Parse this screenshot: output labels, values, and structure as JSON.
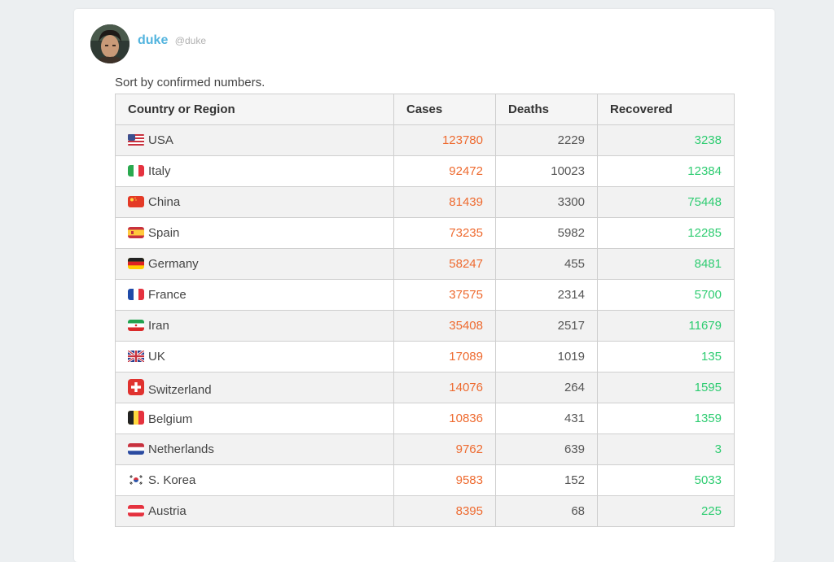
{
  "author": {
    "name": "duke",
    "handle": "@duke"
  },
  "intro": "Sort by confirmed numbers.",
  "colors": {
    "cases": "#ee6a2f",
    "recovered": "#2ecc71",
    "author": "#53b4de"
  },
  "table": {
    "headers": [
      "Country or Region",
      "Cases",
      "Deaths",
      "Recovered"
    ],
    "rows": [
      {
        "flag": "flag-usa-icon",
        "country": "USA",
        "cases": "123780",
        "deaths": "2229",
        "recovered": "3238"
      },
      {
        "flag": "flag-italy-icon",
        "country": "Italy",
        "cases": "92472",
        "deaths": "10023",
        "recovered": "12384"
      },
      {
        "flag": "flag-china-icon",
        "country": "China",
        "cases": "81439",
        "deaths": "3300",
        "recovered": "75448"
      },
      {
        "flag": "flag-spain-icon",
        "country": "Spain",
        "cases": "73235",
        "deaths": "5982",
        "recovered": "12285"
      },
      {
        "flag": "flag-germany-icon",
        "country": "Germany",
        "cases": "58247",
        "deaths": "455",
        "recovered": "8481"
      },
      {
        "flag": "flag-france-icon",
        "country": "France",
        "cases": "37575",
        "deaths": "2314",
        "recovered": "5700"
      },
      {
        "flag": "flag-iran-icon",
        "country": "Iran",
        "cases": "35408",
        "deaths": "2517",
        "recovered": "11679"
      },
      {
        "flag": "flag-uk-icon",
        "country": "UK",
        "cases": "17089",
        "deaths": "1019",
        "recovered": "135"
      },
      {
        "flag": "flag-switzerland-icon",
        "country": "Switzerland",
        "cases": "14076",
        "deaths": "264",
        "recovered": "1595"
      },
      {
        "flag": "flag-belgium-icon",
        "country": "Belgium",
        "cases": "10836",
        "deaths": "431",
        "recovered": "1359"
      },
      {
        "flag": "flag-netherlands-icon",
        "country": "Netherlands",
        "cases": "9762",
        "deaths": "639",
        "recovered": "3"
      },
      {
        "flag": "flag-south-korea-icon",
        "country": "S. Korea",
        "cases": "9583",
        "deaths": "152",
        "recovered": "5033"
      },
      {
        "flag": "flag-austria-icon",
        "country": "Austria",
        "cases": "8395",
        "deaths": "68",
        "recovered": "225"
      }
    ]
  }
}
